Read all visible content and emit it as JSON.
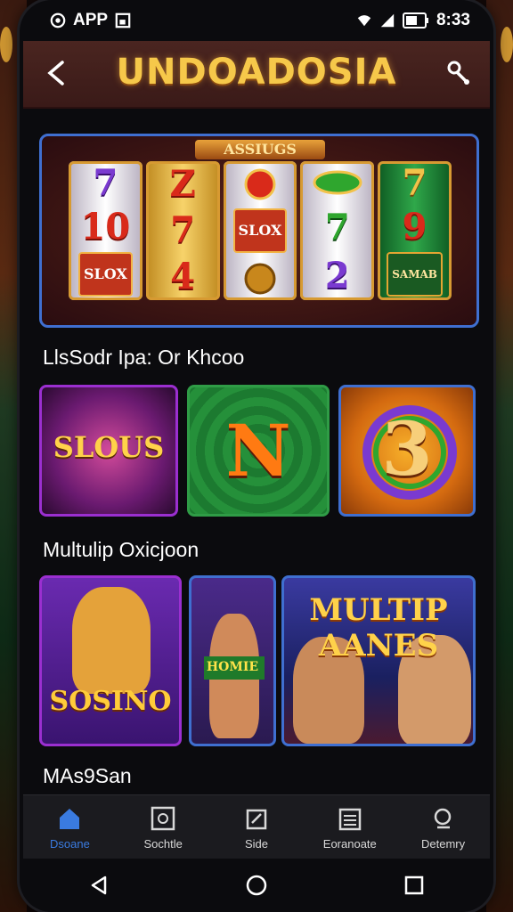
{
  "status_bar": {
    "left_label": "APP",
    "time": "8:33"
  },
  "header": {
    "title": "UNDOADOSIA"
  },
  "banner": {
    "plaque": "ASSIUGS",
    "reels": [
      [
        "7",
        "10",
        "SLOX"
      ],
      [
        "Z",
        "7",
        "4"
      ],
      [
        "",
        "SLOX",
        ""
      ],
      [
        "",
        "7",
        "2"
      ],
      [
        "7",
        "9",
        "SAMAB"
      ]
    ]
  },
  "sections": {
    "first_title": "LlsSodr Ipa: Or Khcoo",
    "second_title": "Multulip Oxicjoon",
    "third_title": "MAs9San"
  },
  "tiles_row1": [
    {
      "label": "SLOUS"
    },
    {
      "label": "N"
    },
    {
      "label": "3"
    }
  ],
  "tiles_row2": [
    {
      "label": "SOSINO"
    },
    {
      "label": "HOMIE"
    },
    {
      "label": "MULTIP AANES"
    }
  ],
  "bottom_nav": [
    {
      "label": "Dsoane",
      "icon": "home-icon",
      "active": true
    },
    {
      "label": "Sochtle",
      "icon": "square-icon",
      "active": false
    },
    {
      "label": "Side",
      "icon": "slide-icon",
      "active": false
    },
    {
      "label": "Eoranoate",
      "icon": "calendar-icon",
      "active": false
    },
    {
      "label": "Detemry",
      "icon": "search-icon",
      "active": false
    }
  ],
  "colors": {
    "accent": "#3a7be0",
    "title_gold": "#f6c84a"
  }
}
